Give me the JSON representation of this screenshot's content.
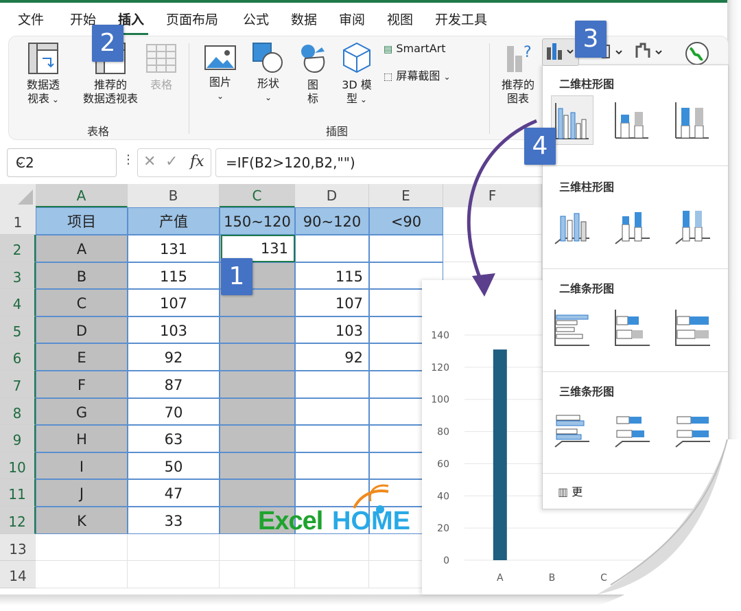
{
  "tabs": [
    "文件",
    "开始",
    "插入",
    "页面布局",
    "公式",
    "数据",
    "审阅",
    "视图",
    "开发工具"
  ],
  "active_tab": "插入",
  "ribbon": {
    "tables": {
      "pivot_line1": "数据透",
      "pivot_line2": "视表",
      "recommended_line1": "推荐的",
      "recommended_line2": "数据透视表",
      "table": "表格",
      "group_label": "表格"
    },
    "illustrations": {
      "picture": "图片",
      "shapes": "形状",
      "icons_line1": "图",
      "icons_line2": "标",
      "model_line1": "3D 模",
      "model_line2": "型",
      "smartart": "SmartArt",
      "screenshot": "屏幕截图",
      "group_label": "插图"
    },
    "charts": {
      "recommended_line1": "推荐的",
      "recommended_line2": "图表"
    }
  },
  "formula_bar": {
    "name_box": "C2",
    "dots": "⋮",
    "cancel": "✕",
    "enter": "✓",
    "fx": "fx",
    "formula": "=IF(B2>120,B2,\"\")"
  },
  "columns": [
    "A",
    "B",
    "C",
    "D",
    "E",
    "F"
  ],
  "rows": [
    "1",
    "2",
    "3",
    "4",
    "5",
    "6",
    "7",
    "8",
    "9",
    "10",
    "11",
    "12",
    "13",
    "14"
  ],
  "table": {
    "headers": [
      "项目",
      "产值",
      "150~120",
      "90~120",
      "<90"
    ],
    "data": [
      [
        "A",
        "131",
        "131",
        ""
      ],
      [
        "B",
        "115",
        "",
        "115"
      ],
      [
        "C",
        "107",
        "",
        "107"
      ],
      [
        "D",
        "103",
        "",
        "103"
      ],
      [
        "E",
        "92",
        "",
        "92"
      ],
      [
        "F",
        "87",
        "",
        ""
      ],
      [
        "G",
        "70",
        "",
        ""
      ],
      [
        "H",
        "63",
        "",
        ""
      ],
      [
        "I",
        "50",
        "",
        ""
      ],
      [
        "J",
        "47",
        "",
        ""
      ],
      [
        "K",
        "33",
        "",
        ""
      ]
    ]
  },
  "badges": [
    "1",
    "2",
    "3",
    "4"
  ],
  "dropdown": {
    "section_2d_column": "二维柱形图",
    "section_3d_column": "三维柱形图",
    "section_2d_bar": "二维条形图",
    "section_3d_bar": "三维条形图",
    "more": "更"
  },
  "chart_data": {
    "type": "bar",
    "categories": [
      "A",
      "B",
      "C"
    ],
    "values": [
      131,
      0,
      0
    ],
    "yticks": [
      "0",
      "20",
      "40",
      "60",
      "80",
      "100",
      "120",
      "140"
    ],
    "ylim": [
      0,
      140
    ],
    "bar_color": "#1f5f7f"
  },
  "logo": {
    "part1": "Excel",
    "part2": "HOME"
  },
  "colors": {
    "accent_green": "#1f7a4a",
    "header_blue": "#9dc3e6",
    "badge_blue": "#4472c4",
    "arrow_purple": "#5b3f8c"
  }
}
